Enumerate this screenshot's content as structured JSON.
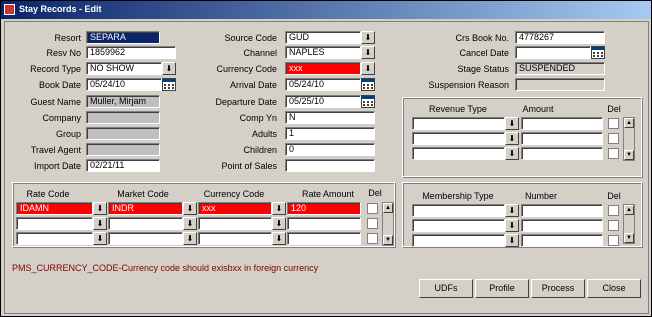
{
  "window": {
    "title": "Stay Records - Edit"
  },
  "left": {
    "resort_label": "Resort",
    "resort": "SEPARA",
    "resv_no_label": "Resv No",
    "resv_no": "1859962",
    "record_type_label": "Record Type",
    "record_type": "NO SHOW",
    "book_date_label": "Book Date",
    "book_date": "05/24/10",
    "guest_name_label": "Guest Name",
    "guest_name": "Muller, Mirjam",
    "company_label": "Company",
    "company": "",
    "group_label": "Group",
    "group": "",
    "travel_agent_label": "Travel Agent",
    "travel_agent": "",
    "import_date_label": "Import Date",
    "import_date": "02/21/11"
  },
  "middle": {
    "source_code_label": "Source Code",
    "source_code": "GUD",
    "channel_label": "Channel",
    "channel": "NAPLES",
    "currency_code_label": "Currency Code",
    "currency_code": "xxx",
    "arrival_date_label": "Arrival Date",
    "arrival_date": "05/24/10",
    "departure_date_label": "Departure Date",
    "departure_date": "05/25/10",
    "comp_yn_label": "Comp Yn",
    "comp_yn": "N",
    "adults_label": "Adults",
    "adults": "1",
    "children_label": "Children",
    "children": "0",
    "point_of_sales_label": "Point of Sales",
    "point_of_sales": ""
  },
  "right": {
    "crs_book_no_label": "Crs Book No.",
    "crs_book_no": "4778267",
    "cancel_date_label": "Cancel Date",
    "cancel_date": "",
    "stage_status_label": "Stage Status",
    "stage_status": "SUSPENDED",
    "suspension_reason_label": "Suspension Reason",
    "suspension_reason": ""
  },
  "revenue": {
    "col_type": "Revenue Type",
    "col_amount": "Amount",
    "col_del": "Del"
  },
  "rates": {
    "col_rate_code": "Rate Code",
    "col_market_code": "Market Code",
    "col_currency_code": "Currency Code",
    "col_rate_amount": "Rate Amount",
    "col_del": "Del",
    "row1": {
      "rate_code": "IDAMN",
      "market_code": "INDR",
      "currency_code": "xxx",
      "rate_amount": "120"
    }
  },
  "membership": {
    "col_type": "Membership Type",
    "col_number": "Number",
    "col_del": "Del"
  },
  "error_message": "PMS_CURRENCY_CODE-Currency code should exisbxx in foreign currency",
  "buttons": {
    "udfs": "UDFs",
    "profile": "Profile",
    "process": "Process",
    "close": "Close"
  },
  "colors": {
    "title_start": "#0a246a",
    "title_end": "#a6caf0",
    "error_field": "#ff0000",
    "selected": "#0a246a",
    "error_text": "#800000"
  }
}
